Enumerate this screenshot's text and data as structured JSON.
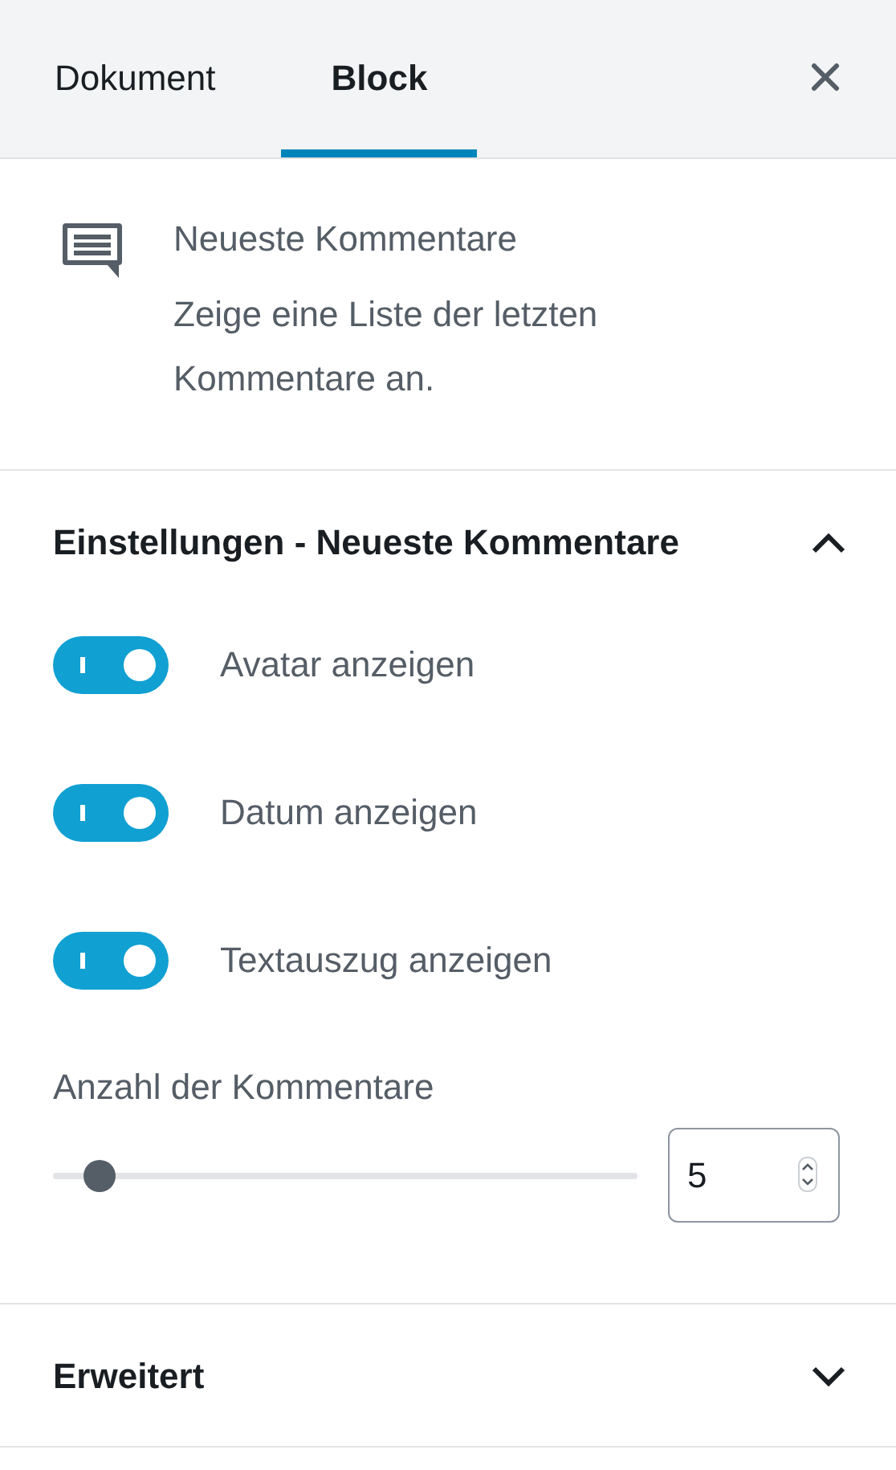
{
  "tabs": [
    {
      "label": "Dokument",
      "selected": false
    },
    {
      "label": "Block",
      "selected": true
    }
  ],
  "block": {
    "title": "Neueste Kommentare",
    "description": "Zeige eine Liste der letzten Kommentare an."
  },
  "panels": [
    {
      "title": "Einstellungen - Neueste Kommentare",
      "expanded": true,
      "toggles": [
        {
          "label": "Avatar anzeigen",
          "checked": true
        },
        {
          "label": "Datum anzeigen",
          "checked": true
        },
        {
          "label": "Textauszug anzeigen",
          "checked": true
        }
      ],
      "range": {
        "label": "Anzahl der Kommentare",
        "level": 0.08,
        "value": "5"
      }
    },
    {
      "title": "Erweitert",
      "expanded": false
    }
  ]
}
